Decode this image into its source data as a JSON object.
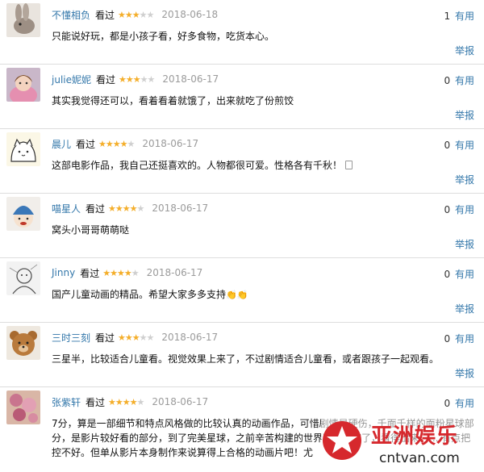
{
  "reviews": [
    {
      "username": "不懂相负",
      "status": "看过",
      "rating": 3,
      "date": "2018-06-18",
      "votes": "1",
      "useful_label": "有用",
      "comment": "只能说好玩，都是小孩子看，好多食物，吃货本心。",
      "report_label": "举报",
      "avatar_icon": "rabbit-avatar"
    },
    {
      "username": "julie妮妮",
      "status": "看过",
      "rating": 3,
      "date": "2018-06-17",
      "votes": "0",
      "useful_label": "有用",
      "comment": "其实我觉得还可以，看着看着就饿了，出来就吃了份煎饺",
      "report_label": "举报",
      "avatar_icon": "girl-avatar"
    },
    {
      "username": "晨儿",
      "status": "看过",
      "rating": 4,
      "date": "2018-06-17",
      "votes": "0",
      "useful_label": "有用",
      "comment": "这部电影作品，我自己还挺喜欢的。人物都很可爱。性格各有千秋！",
      "report_label": "举报",
      "avatar_icon": "cartoon-cat-avatar"
    },
    {
      "username": "喵星人",
      "status": "看过",
      "rating": 4,
      "date": "2018-06-17",
      "votes": "0",
      "useful_label": "有用",
      "comment": "窝头小哥哥萌萌哒",
      "report_label": "举报",
      "avatar_icon": "hat-character-avatar"
    },
    {
      "username": "Jinny",
      "status": "看过",
      "rating": 4,
      "date": "2018-06-17",
      "votes": "0",
      "useful_label": "有用",
      "comment": "国产儿童动画的精品。希望大家多多支持",
      "comment_suffix": "👏👏",
      "report_label": "举报",
      "avatar_icon": "sketch-avatar"
    },
    {
      "username": "三时三刻",
      "status": "看过",
      "rating": 3,
      "date": "2018-06-17",
      "votes": "0",
      "useful_label": "有用",
      "comment": "三星半，比较适合儿童看。视觉效果上来了，不过剧情适合儿童看，或者跟孩子一起观看。",
      "report_label": "举报",
      "avatar_icon": "teddy-bear-avatar"
    },
    {
      "username": "张紫轩",
      "status": "看过",
      "rating": 4,
      "date": "2018-06-17",
      "votes": "0",
      "useful_label": "有用",
      "comment": "7分，算是一部细节和特点风格做的比较认真的动画作品，可惜剧情是硬伤，千面千样的面粉星球部分，是影片较好看的部分，到了完美星球，之前辛苦构建的世界观就白瞎了，看得出来，... 有点把控不好。但单从影片本身制作来说算得上合格的动画片吧！尤",
      "report_label": "举报",
      "avatar_icon": "flowers-avatar"
    }
  ],
  "watermark": {
    "title": "亚洲娱乐",
    "domain": "cntvan.com"
  },
  "colors": {
    "link": "#3377aa",
    "star": "#f4ae2a",
    "date": "#9b9b9b",
    "watermark_red": "#d6282d"
  }
}
